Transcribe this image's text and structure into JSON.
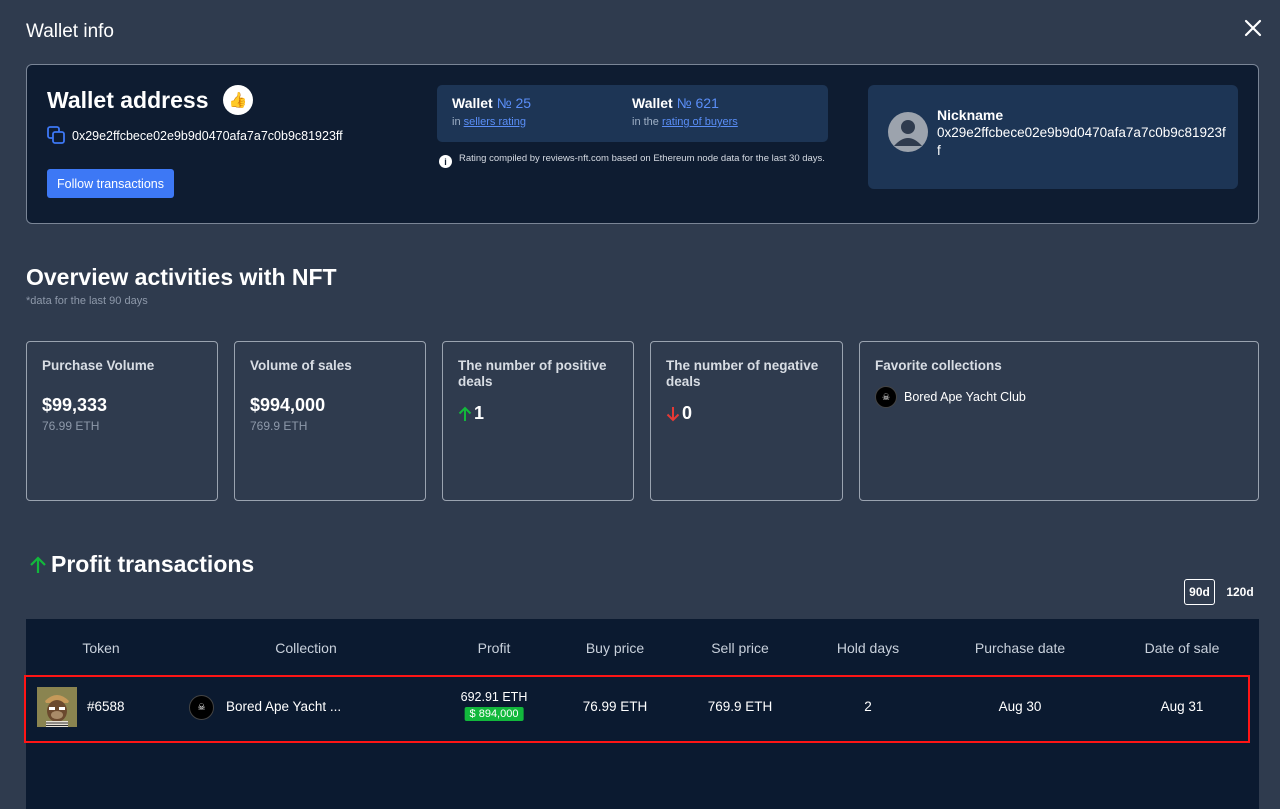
{
  "modal": {
    "title": "Wallet info"
  },
  "wallet": {
    "heading": "Wallet address",
    "address": "0x29e2ffcbece02e9b9d0470afa7a7c0b9c81923ff",
    "follow_label": "Follow transactions",
    "ratings": [
      {
        "prefix": "Wallet",
        "number": "№ 25",
        "pre_link": "in",
        "link": "sellers rating"
      },
      {
        "prefix": "Wallet",
        "number": "№ 621",
        "pre_link": "in the",
        "link": "rating of buyers"
      }
    ],
    "rating_note": "Rating compiled by reviews-nft.com based on Ethereum node data for the last 30 days.",
    "nickname_label": "Nickname",
    "nickname_value": "0x29e2ffcbece02e9b9d0470afa7a7c0b9c81923ff"
  },
  "overview": {
    "title": "Overview activities with NFT",
    "subtitle": "*data for the last 90 days",
    "cards": {
      "purchase": {
        "label": "Purchase Volume",
        "value": "$99,333",
        "sub": "76.99 ETH"
      },
      "sales": {
        "label": "Volume of sales",
        "value": "$994,000",
        "sub": "769.9 ETH"
      },
      "positive": {
        "label": "The number of positive deals",
        "count": "1",
        "arrow_color": "#12b83c"
      },
      "negative": {
        "label": "The number of negative deals",
        "count": "0",
        "arrow_color": "#e53935"
      },
      "favorites": {
        "label": "Favorite collections",
        "items": [
          "Bored Ape Yacht Club"
        ]
      }
    }
  },
  "profit": {
    "title": "Profit transactions",
    "periods": [
      "90d",
      "120d"
    ],
    "columns": [
      "Token",
      "Collection",
      "Profit",
      "Buy price",
      "Sell price",
      "Hold days",
      "Purchase date",
      "Date of sale"
    ],
    "rows": [
      {
        "token": "#6588",
        "collection": "Bored Ape Yacht ...",
        "profit_eth": "692.91 ETH",
        "profit_usd": "$ 894,000",
        "buy_price": "76.99 ETH",
        "sell_price": "769.9 ETH",
        "hold_days": "2",
        "purchase_date": "Aug 30",
        "sale_date": "Aug 31"
      }
    ]
  },
  "colors": {
    "accent": "#3d78f5",
    "positive": "#12b83c",
    "negative": "#e53935",
    "highlight": "#ff1515"
  }
}
